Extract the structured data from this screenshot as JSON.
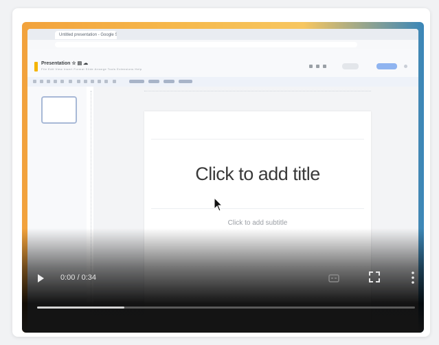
{
  "browser": {
    "tab_title": "Untitled presentation - Google Slides"
  },
  "app": {
    "doc_title": "Presentation ☆ ▤ ☁",
    "menu": "File Edit View Insert Format Slide Arrange Tools Extensions Help"
  },
  "slide": {
    "title_placeholder": "Click to add title",
    "subtitle_placeholder": "Click to add subtitle"
  },
  "player": {
    "time": "0:00 / 0:34",
    "progress": 0.23,
    "icons": {
      "play": "play-icon",
      "captions": "captions-icon",
      "fullscreen": "fullscreen-icon",
      "more": "more-vertical-icon",
      "cursor": "cursor-icon"
    }
  },
  "colors": {
    "accent_share": "#8fb4f0",
    "doc_icon": "#f4b400"
  }
}
